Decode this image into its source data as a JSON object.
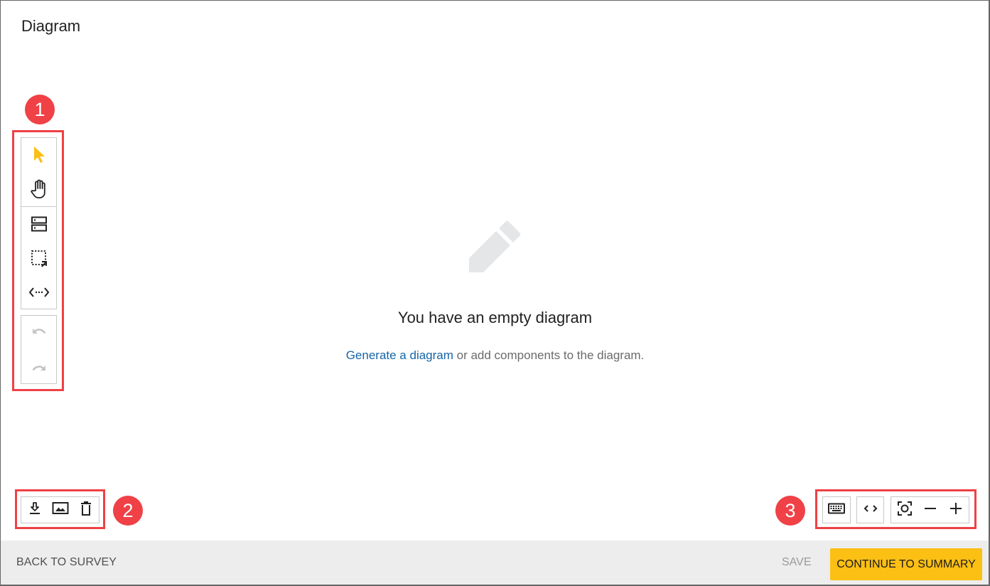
{
  "page": {
    "title": "Diagram"
  },
  "callouts": [
    "1",
    "2",
    "3"
  ],
  "left_toolbar": {
    "groups": [
      {
        "items": [
          {
            "icon": "pointer-icon",
            "label": "Select",
            "active": true
          },
          {
            "icon": "hand-icon",
            "label": "Pan"
          }
        ]
      },
      {
        "items": [
          {
            "icon": "server-icon",
            "label": "Add component"
          },
          {
            "icon": "boundary-select-icon",
            "label": "Add boundary"
          },
          {
            "icon": "dataflow-icon",
            "label": "Add data flow"
          }
        ]
      },
      {
        "items": [
          {
            "icon": "undo-icon",
            "label": "Undo",
            "disabled": true
          },
          {
            "icon": "redo-icon",
            "label": "Redo",
            "disabled": true
          }
        ]
      }
    ]
  },
  "empty_state": {
    "icon": "pencil-icon",
    "title": "You have an empty diagram",
    "link_text": "Generate a diagram",
    "rest_text": " or add components to the diagram."
  },
  "bottom_left_toolbar": {
    "items": [
      {
        "icon": "download-icon",
        "label": "Download"
      },
      {
        "icon": "image-icon",
        "label": "Export image"
      },
      {
        "icon": "trash-icon",
        "label": "Delete"
      }
    ]
  },
  "bottom_right_toolbar": {
    "items": [
      {
        "icon": "keyboard-icon",
        "label": "Keyboard shortcuts"
      },
      {
        "icon": "code-icon",
        "label": "Code view"
      },
      {
        "icon": "fit-screen-icon",
        "label": "Fit to screen"
      },
      {
        "icon": "zoom-out-icon",
        "label": "Zoom out"
      },
      {
        "icon": "zoom-in-icon",
        "label": "Zoom in"
      }
    ]
  },
  "footer": {
    "back_label": "BACK TO SURVEY",
    "save_label": "SAVE",
    "continue_label": "CONTINUE TO SUMMARY"
  },
  "colors": {
    "accent": "#fcbf13",
    "callout": "#ef4146",
    "link": "#1565a8",
    "active_tool": "#fcbf13"
  }
}
